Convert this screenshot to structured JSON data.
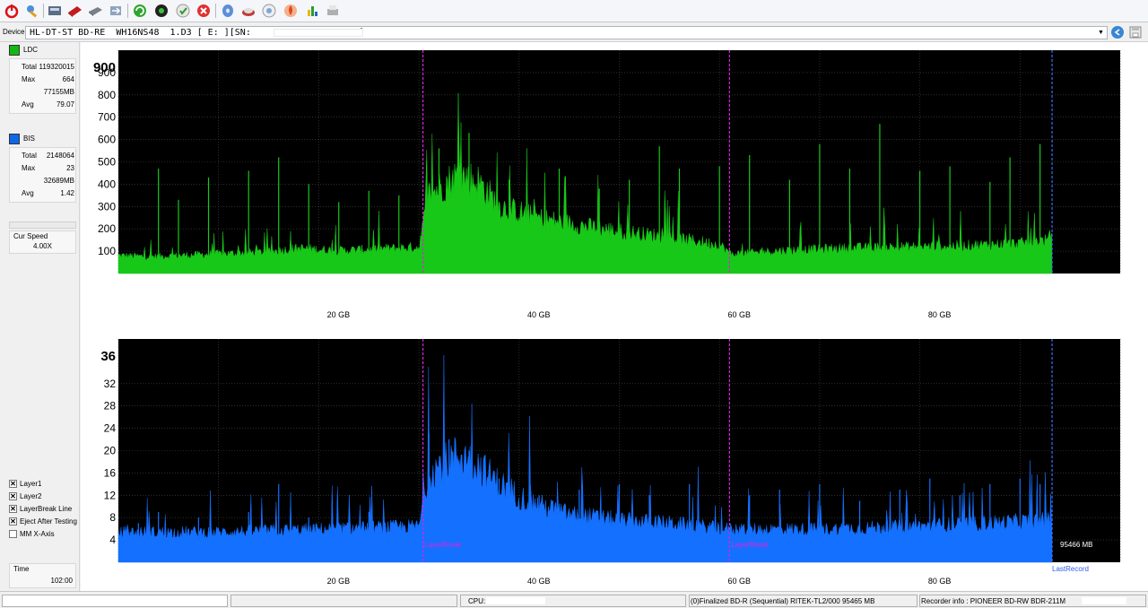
{
  "toolbar": {
    "icons": [
      "power-icon",
      "tools-icon",
      "drive-info-icon",
      "erase-disc-icon",
      "disc-icon",
      "transfer-icon",
      "refresh-icon",
      "record-icon",
      "test-icon",
      "stop-icon",
      "blank-disc-icon",
      "eject-icon",
      "burn-icon",
      "flame-icon",
      "chart-icon",
      "print-icon"
    ]
  },
  "device": {
    "label": "Device:",
    "name": "HL-DT-ST BD-RE  WH16NS48  1.D3 [ E: ][SN:                    ]"
  },
  "legend": {
    "ldc": {
      "name": "LDC",
      "color": "#12b812",
      "stats": [
        {
          "k": "Total",
          "v": "119320015"
        },
        {
          "k": "Max",
          "v": "664"
        },
        {
          "k": "",
          "v": "77155MB"
        },
        {
          "k": "Avg",
          "v": "79.07"
        }
      ]
    },
    "bis": {
      "name": "BIS",
      "color": "#1066e8",
      "stats": [
        {
          "k": "Total",
          "v": "2148064"
        },
        {
          "k": "Max",
          "v": "23"
        },
        {
          "k": "",
          "v": "32689MB"
        },
        {
          "k": "Avg",
          "v": "1.42"
        }
      ]
    }
  },
  "speed": {
    "label": "Cur Speed",
    "value": "4.00X"
  },
  "options": [
    {
      "label": "Layer1",
      "checked": true
    },
    {
      "label": "Layer2",
      "checked": true
    },
    {
      "label": "LayerBreak Line",
      "checked": true
    },
    {
      "label": "Eject After Testing",
      "checked": true
    },
    {
      "label": "MM X-Axis",
      "checked": false
    }
  ],
  "time": {
    "label": "Time",
    "value": "102:00"
  },
  "chart_data": [
    {
      "type": "area",
      "series_name": "LDC",
      "color": "#18c818",
      "xlim": [
        0,
        100
      ],
      "x_ticks": [
        "20 GB",
        "40 GB",
        "60 GB",
        "80 GB"
      ],
      "x_tick_values": [
        20,
        40,
        60,
        80
      ],
      "ylim": [
        0,
        1000
      ],
      "y_ticks": [
        "100",
        "200",
        "300",
        "400",
        "500",
        "600",
        "700",
        "800",
        "900"
      ],
      "y_tick_values": [
        100,
        200,
        300,
        400,
        500,
        600,
        700,
        800,
        900
      ],
      "y_max_label": "900",
      "layer_breaks_gb": [
        30.4,
        61.0
      ],
      "last_record_gb": 93.2,
      "baseline": [
        [
          0,
          75
        ],
        [
          3,
          70
        ],
        [
          8,
          78
        ],
        [
          15,
          90
        ],
        [
          18,
          105
        ],
        [
          22,
          95
        ],
        [
          26,
          102
        ],
        [
          30,
          110
        ],
        [
          31,
          330
        ],
        [
          34,
          410
        ],
        [
          36,
          380
        ],
        [
          38,
          280
        ],
        [
          42,
          230
        ],
        [
          46,
          200
        ],
        [
          50,
          175
        ],
        [
          55,
          150
        ],
        [
          60,
          120
        ],
        [
          61.2,
          80
        ],
        [
          66,
          95
        ],
        [
          72,
          105
        ],
        [
          78,
          110
        ],
        [
          84,
          115
        ],
        [
          90,
          125
        ],
        [
          93,
          140
        ]
      ],
      "spikes": [
        [
          4,
          470
        ],
        [
          6,
          330
        ],
        [
          9,
          430
        ],
        [
          13,
          460
        ],
        [
          16,
          520
        ],
        [
          19,
          400
        ],
        [
          22,
          320
        ],
        [
          25,
          370
        ],
        [
          28,
          350
        ],
        [
          32,
          560
        ],
        [
          35,
          630
        ],
        [
          39,
          420
        ],
        [
          44,
          470
        ],
        [
          48,
          380
        ],
        [
          51,
          420
        ],
        [
          54,
          570
        ],
        [
          56,
          470
        ],
        [
          60,
          480
        ],
        [
          63,
          530
        ],
        [
          67,
          420
        ],
        [
          70,
          580
        ],
        [
          73,
          470
        ],
        [
          76,
          670
        ],
        [
          80,
          460
        ],
        [
          83,
          480
        ],
        [
          87,
          410
        ],
        [
          89,
          520
        ],
        [
          92,
          580
        ]
      ]
    },
    {
      "type": "area",
      "series_name": "BIS",
      "color": "#1470ff",
      "xlim": [
        0,
        100
      ],
      "x_ticks": [
        "20 GB",
        "40 GB",
        "60 GB",
        "80 GB"
      ],
      "x_tick_values": [
        20,
        40,
        60,
        80
      ],
      "ylim": [
        0,
        40
      ],
      "y_ticks": [
        "4",
        "8",
        "12",
        "16",
        "20",
        "24",
        "28",
        "32"
      ],
      "y_tick_values": [
        4,
        8,
        12,
        16,
        20,
        24,
        28,
        32
      ],
      "y_max_label": "36",
      "layer_breaks_gb": [
        30.4,
        61.0
      ],
      "last_record_gb": 93.2,
      "layer_break_label": "LayerBreak",
      "end_label": "95466 MB",
      "last_record_label": "LastRecord",
      "baseline": [
        [
          0,
          5
        ],
        [
          10,
          5
        ],
        [
          20,
          5.5
        ],
        [
          30,
          6
        ],
        [
          31,
          15
        ],
        [
          34,
          18
        ],
        [
          36,
          16
        ],
        [
          38,
          13
        ],
        [
          41,
          10
        ],
        [
          45,
          8
        ],
        [
          50,
          7
        ],
        [
          55,
          6.5
        ],
        [
          61,
          5.5
        ],
        [
          70,
          5.5
        ],
        [
          80,
          6
        ],
        [
          93,
          7
        ]
      ],
      "spikes": [
        [
          2,
          7
        ],
        [
          4,
          9
        ],
        [
          8,
          8
        ],
        [
          13,
          9
        ],
        [
          16,
          14
        ],
        [
          19,
          8
        ],
        [
          25,
          9
        ],
        [
          31,
          23
        ],
        [
          33,
          22
        ],
        [
          35,
          20
        ],
        [
          38,
          15
        ],
        [
          42,
          12
        ],
        [
          46,
          13
        ],
        [
          50,
          14
        ],
        [
          53,
          12
        ],
        [
          57,
          14
        ],
        [
          63,
          12
        ],
        [
          66,
          13
        ],
        [
          70,
          14
        ],
        [
          74,
          11
        ],
        [
          78,
          13
        ],
        [
          81,
          15
        ],
        [
          84,
          12
        ],
        [
          87,
          14
        ],
        [
          90,
          15
        ],
        [
          92,
          14
        ]
      ]
    }
  ],
  "status": {
    "cpu_label": "CPU:",
    "disc_info": "(0)Finalized  BD-R (Sequential)  RITEK-TL2/000  95465 MB",
    "recorder_info": "Recorder info : PIONEER      BD-RW  BDR-211M"
  }
}
